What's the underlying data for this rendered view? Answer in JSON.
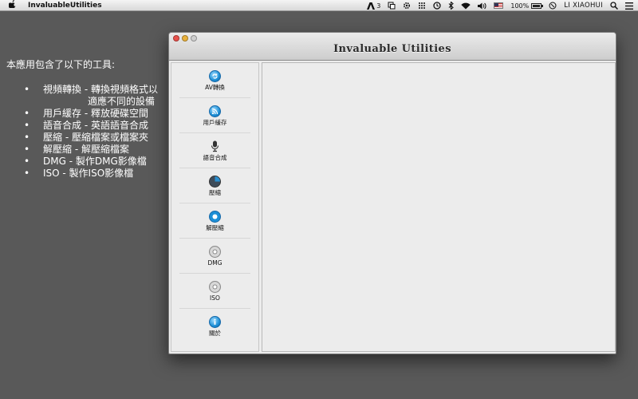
{
  "menubar": {
    "app_name": "InvaluableUtilities",
    "adobe_badge": "3",
    "battery": "100%",
    "user": "LI XIAOHUI"
  },
  "desktop": {
    "heading": "本應用包含了以下的工具:",
    "tools": [
      {
        "line": "視頻轉換 - 轉換視頻格式以",
        "cont": "適應不同的設備"
      },
      {
        "line": "用戶緩存 -  釋放硬碟空間",
        "cont": ""
      },
      {
        "line": "語音合成 - 英語語音合成",
        "cont": ""
      },
      {
        "line": "壓縮 - 壓縮檔案或檔案夾",
        "cont": ""
      },
      {
        "line": "解壓縮 - 解壓縮檔案",
        "cont": ""
      },
      {
        "line": "DMG - 製作DMG影像檔",
        "cont": ""
      },
      {
        "line": "ISO - 製作ISO影像檔",
        "cont": ""
      }
    ]
  },
  "window": {
    "title": "Invaluable Utilities",
    "sidebar": [
      {
        "label": "AV轉換",
        "icon": "av-convert-icon"
      },
      {
        "label": "用戶緩存",
        "icon": "rss-icon"
      },
      {
        "label": "語音合成",
        "icon": "microphone-icon"
      },
      {
        "label": "壓縮",
        "icon": "compress-icon"
      },
      {
        "label": "解壓縮",
        "icon": "decompress-icon"
      },
      {
        "label": "DMG",
        "icon": "disc-icon"
      },
      {
        "label": "ISO",
        "icon": "disc-icon"
      },
      {
        "label": "關於",
        "icon": "info-icon"
      }
    ]
  },
  "colors": {
    "desktop": "#595959",
    "accent_blue": "#1d8fd6",
    "close": "#e8514b",
    "minimize": "#e9b13c"
  }
}
